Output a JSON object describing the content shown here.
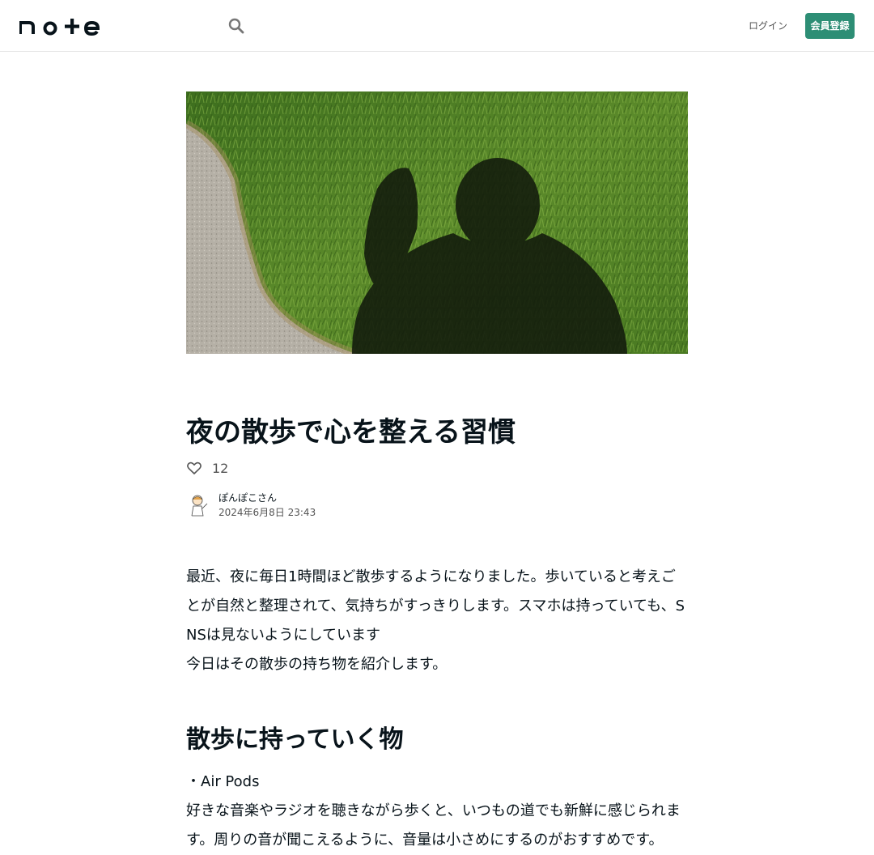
{
  "header": {
    "logo_text": "note",
    "login_label": "ログイン",
    "signup_label": "会員登録",
    "search_icon": "search-icon",
    "accent_color": "#2d8e75"
  },
  "article": {
    "hero_image": "shadow-on-grass-photo",
    "title": "夜の散歩で心を整える習慣",
    "like_count": "12",
    "author_name": "ぽんぽこさん",
    "date": "2024年6月8日 23:43",
    "paragraphs": [
      "最近、夜に毎日1時間ほど散歩するようになりました。歩いていると考えごとが自然と整理されて、気持ちがすっきりします。スマホは持っていても、SNSは見ないようにしています",
      "今日はその散歩の持ち物を紹介します。"
    ],
    "section_heading": "散歩に持っていく物",
    "item_label": "・Air Pods",
    "item_paragraph": "好きな音楽やラジオを聴きながら歩くと、いつもの道でも新鮮に感じられます。周りの音が聞こえるように、音量は小さめにするのがおすすめです。"
  }
}
